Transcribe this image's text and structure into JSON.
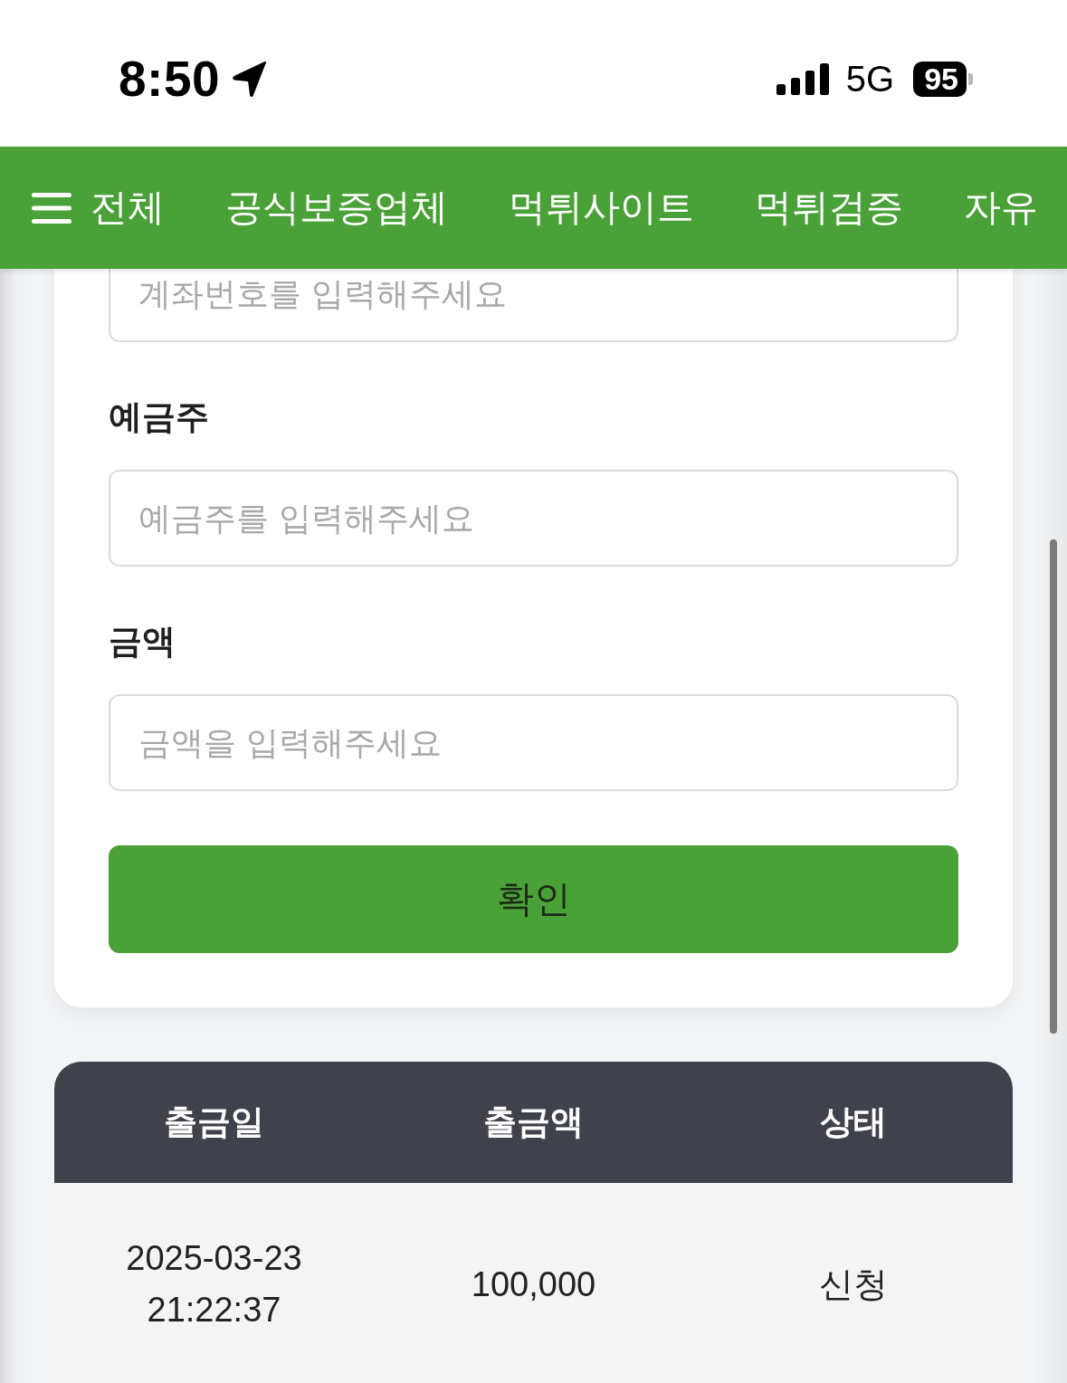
{
  "status_bar": {
    "time": "8:50",
    "network": "5G",
    "battery": "95"
  },
  "nav": {
    "items": [
      "전체",
      "공식보증업체",
      "먹튀사이트",
      "먹튀검증",
      "자유"
    ]
  },
  "form": {
    "fields": [
      {
        "placeholder": "계좌번호를 입력해주세요"
      },
      {
        "label": "예금주",
        "placeholder": "예금주를 입력해주세요"
      },
      {
        "label": "금액",
        "placeholder": "금액을 입력해주세요"
      }
    ],
    "submit": "확인"
  },
  "table": {
    "columns": [
      "출금일",
      "출금액",
      "상태"
    ],
    "rows": [
      [
        "2025-03-23 21:22:37",
        "100,000",
        "신청"
      ]
    ]
  }
}
